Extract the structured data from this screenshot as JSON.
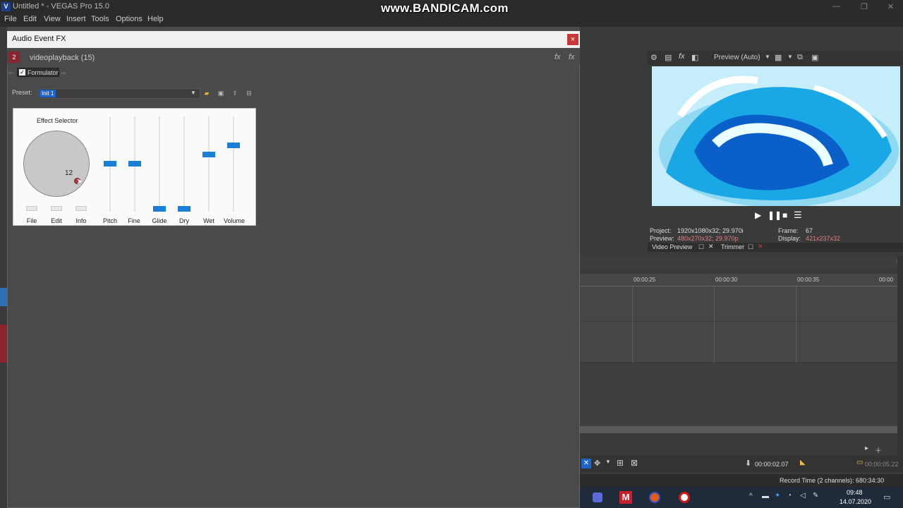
{
  "app": {
    "title": "Untitled * - VEGAS Pro 15.0",
    "icon_letter": "V",
    "watermark": "www.BANDICAM.com"
  },
  "menu": {
    "items": [
      "File",
      "Edit",
      "View",
      "Insert",
      "Tools",
      "Options",
      "Help"
    ]
  },
  "fx_dialog": {
    "title": "Audio Event FX",
    "close_glyph": "×",
    "chain_icon": "2",
    "chain_name": "videoplayback (15)",
    "plugin_name": "Formulator",
    "preset_label": "Preset:",
    "preset_value": "Init 1",
    "fx_icons": [
      "fx-icon",
      "fx-remove-icon"
    ],
    "preset_buttons": [
      "folder-icon",
      "save-icon",
      "export-icon",
      "delete-icon"
    ]
  },
  "plugin": {
    "effect_selector_label": "Effect Selector",
    "dial_value": "12",
    "bottom_labels": [
      "File",
      "Edit",
      "Info"
    ],
    "sliders": [
      {
        "label": "Pitch",
        "level": 0.5
      },
      {
        "label": "Fine",
        "level": 0.5
      },
      {
        "label": "Glide",
        "level": 0.0
      },
      {
        "label": "Dry",
        "level": 0.0
      },
      {
        "label": "Wet",
        "level": 0.6
      },
      {
        "label": "Volume",
        "level": 0.7
      }
    ]
  },
  "preview": {
    "mode": "Preview (Auto)",
    "project_label": "Project:",
    "project_value": "1920x1080x32; 29.970i",
    "preview_label": "Preview:",
    "preview_value": "480x270x32; 29.970p",
    "frame_label": "Frame:",
    "frame_value": "67",
    "display_label": "Display:",
    "display_value": "421x237x32",
    "tab_video": "Video Preview",
    "tab_trimmer": "Trimmer"
  },
  "timeline": {
    "ruler": [
      "00:00:25",
      "00:00:30",
      "00:00:35",
      "00:00"
    ],
    "cursor_time": "00:00:02.07",
    "end_time": "00:00:05.22"
  },
  "status": {
    "record_time": "Record Time (2 channels): 680:34:30"
  },
  "clock": {
    "time": "09:48",
    "date": "14.07.2020"
  },
  "colors": {
    "accent": "#1a7fd6",
    "close": "#c8383a",
    "chain": "#8a2430"
  }
}
